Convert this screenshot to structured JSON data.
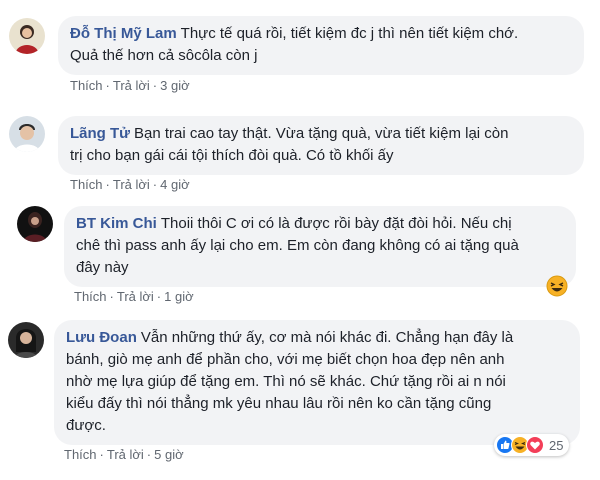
{
  "comments": [
    {
      "author": "Đỗ Thị Mỹ Lam",
      "lines": [
        "Thực tế quá rồi, tiết kiệm đc j thì nên tiết kiệm chớ.",
        "Quả thế hơn cả sôcôla còn j"
      ],
      "like": "Thích",
      "reply": "Trả lời",
      "time": "3 giờ"
    },
    {
      "author": "Lãng Tử",
      "lines": [
        "Bạn trai cao tay thật. Vừa tặng quà, vừa tiết kiệm lại còn",
        "trị cho bạn gái cái tội thích đòi quà. Có tồ khối ấy"
      ],
      "like": "Thích",
      "reply": "Trả lời",
      "time": "4 giờ"
    },
    {
      "author": "BT Kim Chi",
      "lines": [
        "Thoii thôi C ơi có là được rồi bày đặt đòi hỏi. Nếu chị",
        "chê thì pass anh ấy lại cho em. Em còn đang không có ai tặng quà",
        "đây này"
      ],
      "like": "Thích",
      "reply": "Trả lời",
      "time": "1 giờ",
      "reaction_icon": "laughing-emoji-icon"
    },
    {
      "author": "Lưu Đoan",
      "lines": [
        "Vẫn những thứ ấy, cơ mà nói khác đi. Chẳng hạn đây là",
        "bánh, giò mẹ anh để phần cho, với mẹ biết chọn hoa đẹp nên anh",
        "nhờ mẹ lựa giúp để tặng em. Thì nó sẽ khác. Chứ tặng rồi ai n nói",
        "kiểu đấy thì nói thẳng mk yêu nhau lâu rồi nên ko cần tặng cũng",
        "được."
      ],
      "like": "Thích",
      "reply": "Trả lời",
      "time": "5 giờ",
      "reactions": {
        "icons": [
          "like-icon",
          "haha-icon",
          "love-icon"
        ],
        "count": "25"
      }
    }
  ],
  "separator": "·",
  "colors": {
    "author": "#385898",
    "bubble": "#f2f3f5",
    "meta": "#606770",
    "like": "#1877f2",
    "love": "#f33e58",
    "haha": "#f7b125"
  }
}
